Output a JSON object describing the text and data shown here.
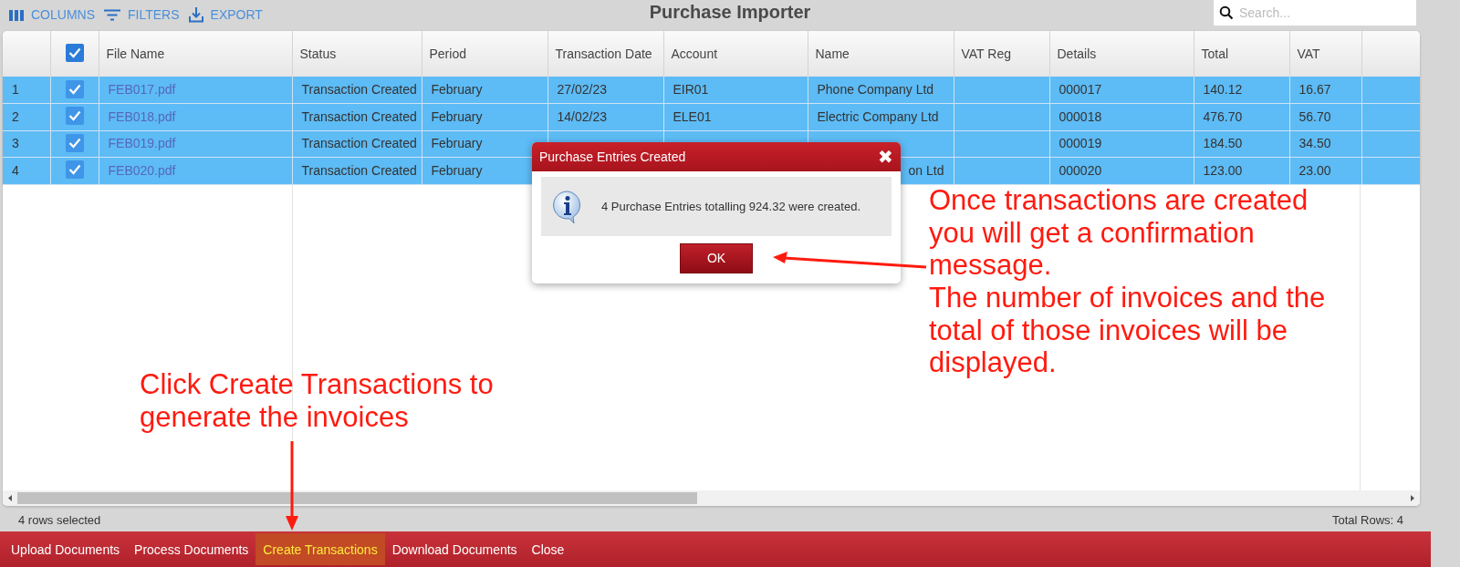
{
  "toolbar": {
    "buttons": [
      {
        "label": "COLUMNS",
        "kind": "columns"
      },
      {
        "label": "FILTERS",
        "kind": "filters"
      },
      {
        "label": "EXPORT",
        "kind": "export"
      }
    ],
    "title": "Purchase Importer",
    "search": {
      "placeholder": "Search..."
    }
  },
  "table": {
    "header_checked": true,
    "columns": [
      "File Name",
      "Status",
      "Period",
      "Transaction Date",
      "Account",
      "Name",
      "VAT Reg",
      "Details",
      "Total",
      "VAT"
    ],
    "rows": [
      {
        "number": "1",
        "selected": true,
        "checked": true,
        "cells": [
          "FEB017.pdf",
          "Transaction Created",
          "February",
          "27/02/23",
          "EIR01",
          "Phone Company Ltd",
          "",
          "000017",
          "140.12",
          "16.67"
        ]
      },
      {
        "number": "2",
        "selected": true,
        "checked": true,
        "cells": [
          "FEB018.pdf",
          "Transaction Created",
          "February",
          "14/02/23",
          "ELE01",
          "Electric Company Ltd",
          "",
          "000018",
          "476.70",
          "56.70"
        ]
      },
      {
        "number": "3",
        "selected": true,
        "checked": true,
        "cells": [
          "FEB019.pdf",
          "Transaction Created",
          "February",
          "",
          "",
          "",
          "",
          "000019",
          "184.50",
          "34.50"
        ]
      },
      {
        "number": "4",
        "selected": true,
        "checked": true,
        "cells": [
          "FEB020.pdf",
          "Transaction Created",
          "February",
          "",
          "",
          "on Ltd",
          "",
          "000020",
          "123.00",
          "23.00"
        ]
      }
    ]
  },
  "status_bar": {
    "selection": "4 rows selected",
    "total": "Total Rows: 4"
  },
  "menu": [
    {
      "label": "Upload Documents",
      "highlighted": false
    },
    {
      "label": "Process Documents",
      "highlighted": false
    },
    {
      "label": "Create Transactions",
      "highlighted": true
    },
    {
      "label": "Download Documents",
      "highlighted": false
    },
    {
      "label": "Close",
      "highlighted": false
    }
  ],
  "dialog": {
    "title": "Purchase Entries Created",
    "close": "✖",
    "message": "4 Purchase Entries totalling 924.32 were created.",
    "button": "OK"
  },
  "annotations": [
    {
      "kind": "dialog",
      "paragraphs": [
        "Once transactions are created you will get a confirmation message.",
        "The number of invoices and the total of those invoices will be displayed."
      ]
    },
    {
      "kind": "menu",
      "paragraphs": [
        "Click Create Transactions to generate the invoices"
      ]
    }
  ]
}
